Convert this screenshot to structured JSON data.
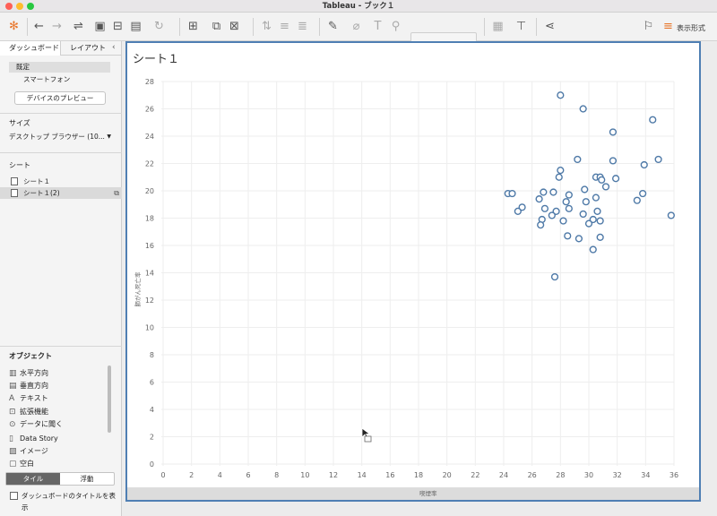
{
  "window": {
    "title": "Tableau - ブック１"
  },
  "toolbar": {
    "icons": [
      "tableau-logo-icon",
      "back-icon",
      "forward-icon",
      "connect-icon",
      "save-icon",
      "new-datasource-icon",
      "refresh-icon",
      "new-sheet-icon",
      "duplicate-icon",
      "clear-icon",
      "swap-icon",
      "sort-asc-icon",
      "sort-desc-icon",
      "highlight-icon",
      "paperclip-icon",
      "label-icon",
      "pin-icon",
      "fit-icon",
      "presentation-icon",
      "share-icon"
    ],
    "show_me_label": "表示形式"
  },
  "left_panel": {
    "tabs": [
      "ダッシュボード",
      "レイアウト"
    ],
    "device_default": "既定",
    "device_phone": "スマートフォン",
    "preview_button": "デバイスのプレビュー",
    "size_title": "サイズ",
    "size_value": "デスクトップ ブラウザー (10...",
    "sheets_title": "シート",
    "sheets": [
      "シート１",
      "シート１(2)"
    ],
    "objects_title": "オブジェクト",
    "objects": [
      {
        "icon": "horizontal-icon",
        "label": "水平方向"
      },
      {
        "icon": "vertical-icon",
        "label": "垂直方向"
      },
      {
        "icon": "text-icon",
        "label": "テキスト"
      },
      {
        "icon": "extension-icon",
        "label": "拡張機能"
      },
      {
        "icon": "ask-data-icon",
        "label": "データに聞く"
      },
      {
        "icon": "data-story-icon",
        "label": "Data Story"
      },
      {
        "icon": "image-icon",
        "label": "イメージ"
      },
      {
        "icon": "blank-icon",
        "label": "空白"
      }
    ],
    "tile_tabs": [
      "タイル",
      "浮動"
    ],
    "show_title_label": "ダッシュボードのタイトルを表示"
  },
  "canvas": {
    "sheet_title": "シート１"
  },
  "chart_data": {
    "type": "scatter",
    "xlabel": "喫煙率",
    "ylabel": "肺がん死亡率",
    "xlim": [
      0,
      36
    ],
    "ylim": [
      0,
      28
    ],
    "x_ticks": [
      0,
      2,
      4,
      6,
      8,
      10,
      12,
      14,
      16,
      18,
      20,
      22,
      24,
      26,
      28,
      30,
      32,
      34,
      36
    ],
    "y_ticks": [
      0,
      2,
      4,
      6,
      8,
      10,
      12,
      14,
      16,
      18,
      20,
      22,
      24,
      26,
      28
    ],
    "grid": true,
    "marker_color": "#4e79a7",
    "points": [
      {
        "x": 28.0,
        "y": 27.0
      },
      {
        "x": 29.6,
        "y": 26.0
      },
      {
        "x": 34.5,
        "y": 25.2
      },
      {
        "x": 31.7,
        "y": 24.3
      },
      {
        "x": 34.9,
        "y": 22.3
      },
      {
        "x": 29.2,
        "y": 22.3
      },
      {
        "x": 31.7,
        "y": 22.2
      },
      {
        "x": 33.9,
        "y": 21.9
      },
      {
        "x": 28.0,
        "y": 21.5
      },
      {
        "x": 27.9,
        "y": 21.0
      },
      {
        "x": 30.5,
        "y": 21.0
      },
      {
        "x": 30.8,
        "y": 21.0
      },
      {
        "x": 31.9,
        "y": 20.9
      },
      {
        "x": 30.9,
        "y": 20.8
      },
      {
        "x": 31.2,
        "y": 20.3
      },
      {
        "x": 29.7,
        "y": 20.1
      },
      {
        "x": 24.3,
        "y": 19.8
      },
      {
        "x": 24.6,
        "y": 19.8
      },
      {
        "x": 26.8,
        "y": 19.9
      },
      {
        "x": 27.5,
        "y": 19.9
      },
      {
        "x": 33.8,
        "y": 19.8
      },
      {
        "x": 28.6,
        "y": 19.7
      },
      {
        "x": 30.5,
        "y": 19.5
      },
      {
        "x": 26.5,
        "y": 19.4
      },
      {
        "x": 28.4,
        "y": 19.2
      },
      {
        "x": 29.8,
        "y": 19.2
      },
      {
        "x": 33.4,
        "y": 19.3
      },
      {
        "x": 25.3,
        "y": 18.8
      },
      {
        "x": 25.0,
        "y": 18.5
      },
      {
        "x": 26.9,
        "y": 18.7
      },
      {
        "x": 28.6,
        "y": 18.7
      },
      {
        "x": 27.7,
        "y": 18.5
      },
      {
        "x": 30.6,
        "y": 18.5
      },
      {
        "x": 29.6,
        "y": 18.3
      },
      {
        "x": 27.4,
        "y": 18.2
      },
      {
        "x": 35.8,
        "y": 18.2
      },
      {
        "x": 26.7,
        "y": 17.9
      },
      {
        "x": 28.2,
        "y": 17.8
      },
      {
        "x": 30.3,
        "y": 17.9
      },
      {
        "x": 30.8,
        "y": 17.8
      },
      {
        "x": 30.0,
        "y": 17.6
      },
      {
        "x": 26.6,
        "y": 17.5
      },
      {
        "x": 28.5,
        "y": 16.7
      },
      {
        "x": 29.3,
        "y": 16.5
      },
      {
        "x": 30.8,
        "y": 16.6
      },
      {
        "x": 30.3,
        "y": 15.7
      },
      {
        "x": 27.6,
        "y": 13.7
      }
    ]
  },
  "cursor": {
    "icon": "mouse-pointer-icon"
  }
}
